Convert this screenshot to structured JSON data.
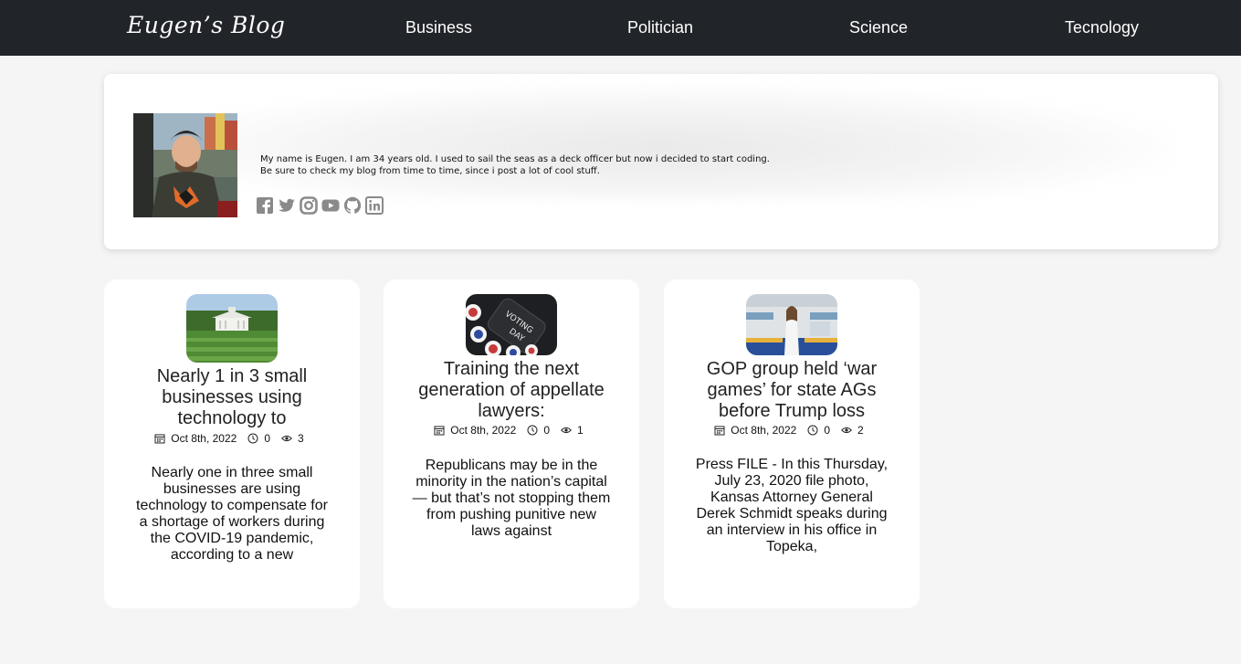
{
  "nav": {
    "brand": "Eugen’s Blog",
    "links": [
      "Business",
      "Politician",
      "Science",
      "Tecnology"
    ]
  },
  "profile": {
    "bio_line1": "My name is Eugen. I am 34 years old. I used to sail the seas as a deck officer but now i decided to start coding.",
    "bio_line2": "Be sure to check my blog from time to time, since i post a lot of cool stuff.",
    "socials": [
      "facebook-icon",
      "twitter-icon",
      "instagram-icon",
      "youtube-icon",
      "github-icon",
      "linkedin-icon"
    ]
  },
  "posts": [
    {
      "title": "Nearly 1 in 3 small businesses using technology to",
      "date": "Oct 8th, 2022",
      "comments": "0",
      "views": "3",
      "excerpt": "Nearly one in three small businesses are using technology to compensate for a shortage of workers during the COVID-19 pandemic, according to a new"
    },
    {
      "title": "Training the next generation of appellate lawyers:",
      "date": "Oct 8th, 2022",
      "comments": "0",
      "views": "1",
      "excerpt": "Republicans may be in the minority in the nation’s capital — but that’s not stopping them from pushing punitive new laws against"
    },
    {
      "title": "GOP group held ‘war games’ for state AGs before Trump loss",
      "date": "Oct 8th, 2022",
      "comments": "0",
      "views": "2",
      "excerpt": "Press FILE - In this Thursday, July 23, 2020 file photo, Kansas Attorney General Derek Schmidt speaks during an interview in his office in Topeka,"
    }
  ],
  "colors": {
    "navbar": "#212428",
    "page_bg": "#f5f5f5",
    "card_bg": "#ffffff",
    "social_icon": "#8a8a8a"
  }
}
